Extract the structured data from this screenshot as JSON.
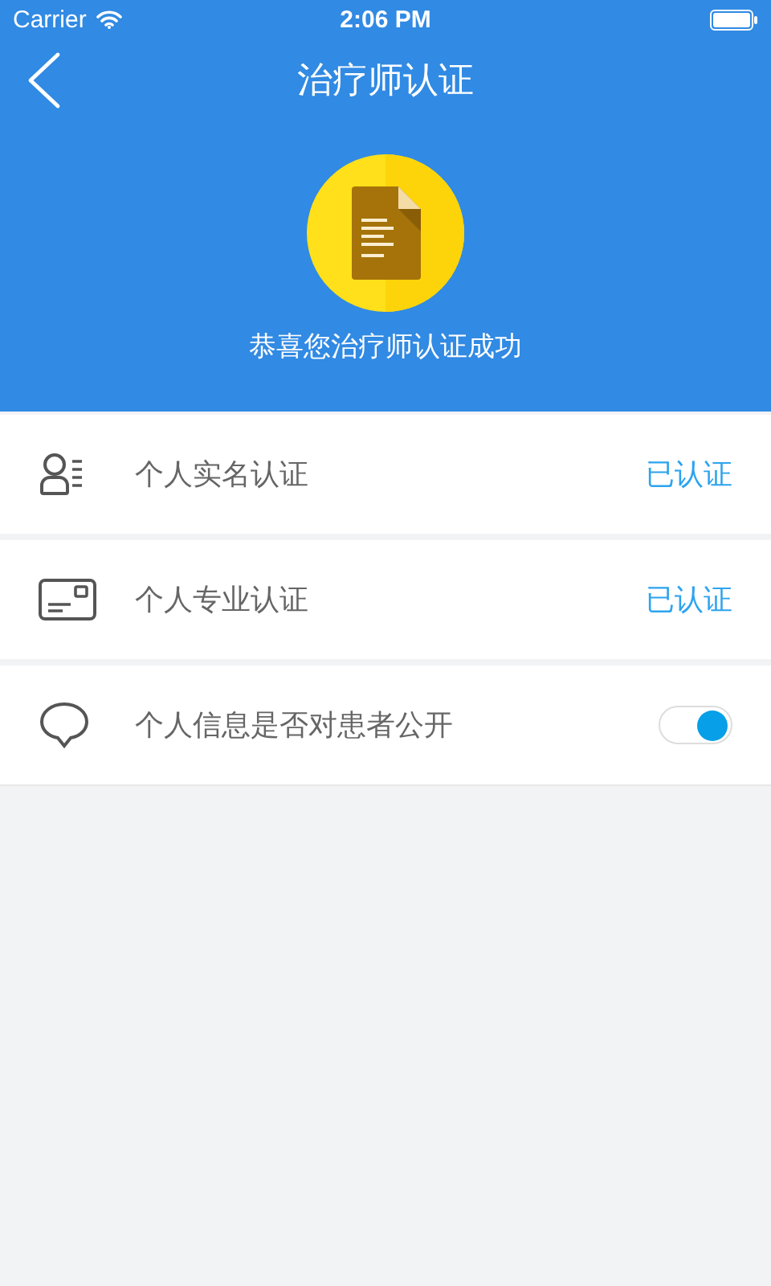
{
  "status_bar": {
    "carrier": "Carrier",
    "time": "2:06 PM"
  },
  "nav": {
    "title": "治疗师认证"
  },
  "hero": {
    "message": "恭喜您治疗师认证成功"
  },
  "rows": [
    {
      "kind": "status",
      "label": "个人实名认证",
      "status": "已认证"
    },
    {
      "kind": "status",
      "label": "个人专业认证",
      "status": "已认证"
    },
    {
      "kind": "toggle",
      "label": "个人信息是否对患者公开",
      "on": true
    }
  ]
}
